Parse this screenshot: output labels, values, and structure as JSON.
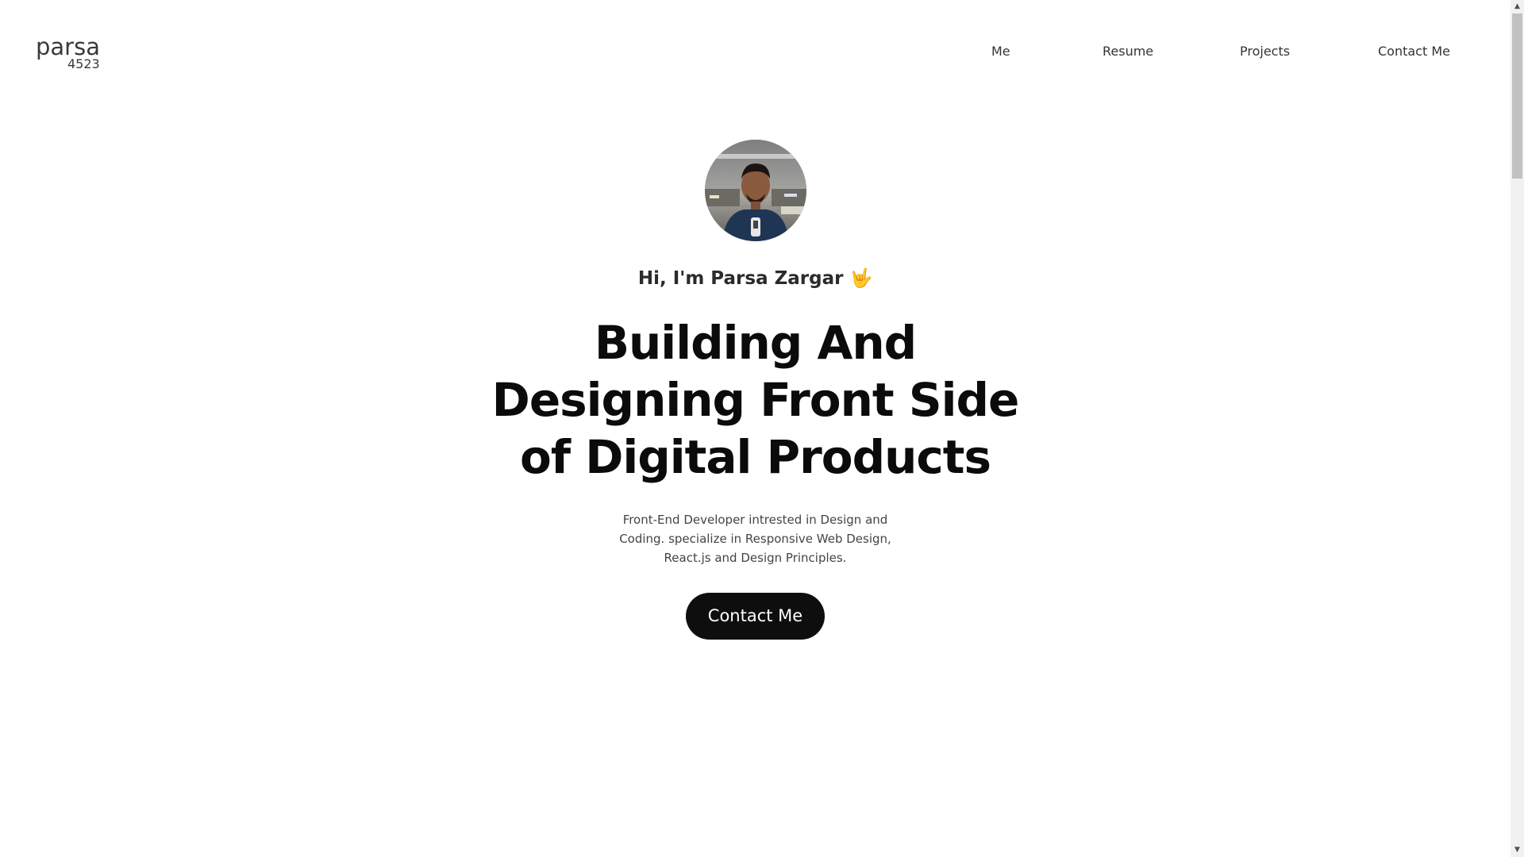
{
  "logo": {
    "top_text": "parsa",
    "bottom_text": "4523"
  },
  "nav": {
    "items": [
      {
        "label": "Me"
      },
      {
        "label": "Resume"
      },
      {
        "label": "Projects"
      },
      {
        "label": "Contact Me"
      }
    ]
  },
  "hero": {
    "avatar_icon": "profile-photo",
    "greeting": "Hi, I'm Parsa Zargar 🤟",
    "headline_lines": [
      "Building And",
      "Designing Front Side",
      "of Digital Products"
    ],
    "subtitle_lines": [
      "Front-End Developer intrested in Design and",
      "Coding. specialize in Responsive Web Design,",
      "React.js and Design Principles."
    ],
    "cta_label": "Contact Me"
  },
  "scrollbar": {
    "up_icon": "▲",
    "down_icon": "▼"
  },
  "colors": {
    "background": "#ffffff",
    "text": "#0b0b0b",
    "cta_background": "#0e0e0e",
    "cta_text": "#ffffff"
  }
}
